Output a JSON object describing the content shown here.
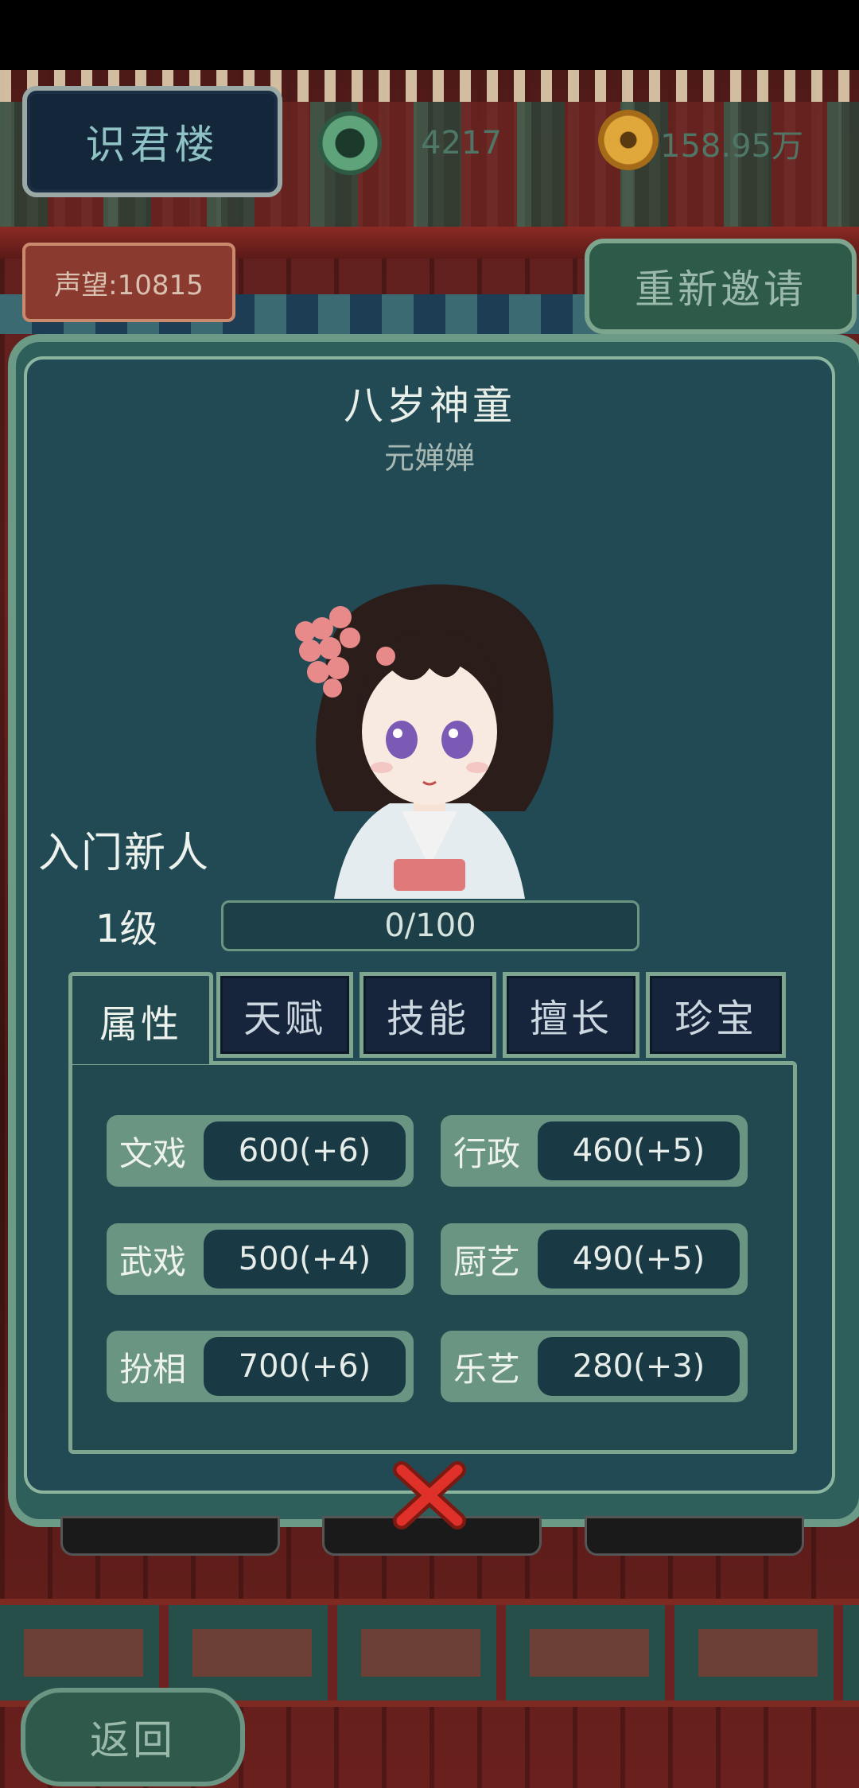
{
  "header": {
    "building_name": "识君楼",
    "jade_amount": "4217",
    "coin_amount": "158.95万",
    "prestige": "声望:10815",
    "reinvite_label": "重新邀请"
  },
  "character": {
    "title": "八岁神童",
    "name": "元婵婵",
    "rank": "入门新人",
    "level": "1级",
    "xp": "0/100",
    "xp_fraction": 0
  },
  "tabs": [
    {
      "label": "属性",
      "active": true
    },
    {
      "label": "天赋",
      "active": false
    },
    {
      "label": "技能",
      "active": false
    },
    {
      "label": "擅长",
      "active": false
    },
    {
      "label": "珍宝",
      "active": false
    }
  ],
  "stats": [
    {
      "label": "文戏",
      "value": "600(+6)"
    },
    {
      "label": "行政",
      "value": "460(+5)"
    },
    {
      "label": "武戏",
      "value": "500(+4)"
    },
    {
      "label": "厨艺",
      "value": "490(+5)"
    },
    {
      "label": "扮相",
      "value": "700(+6)"
    },
    {
      "label": "乐艺",
      "value": "280(+3)"
    }
  ],
  "footer": {
    "back_label": "返回"
  },
  "icons": {
    "jade": "jade-bi-icon",
    "coin": "copper-coin-icon",
    "close": "close-x-icon"
  }
}
